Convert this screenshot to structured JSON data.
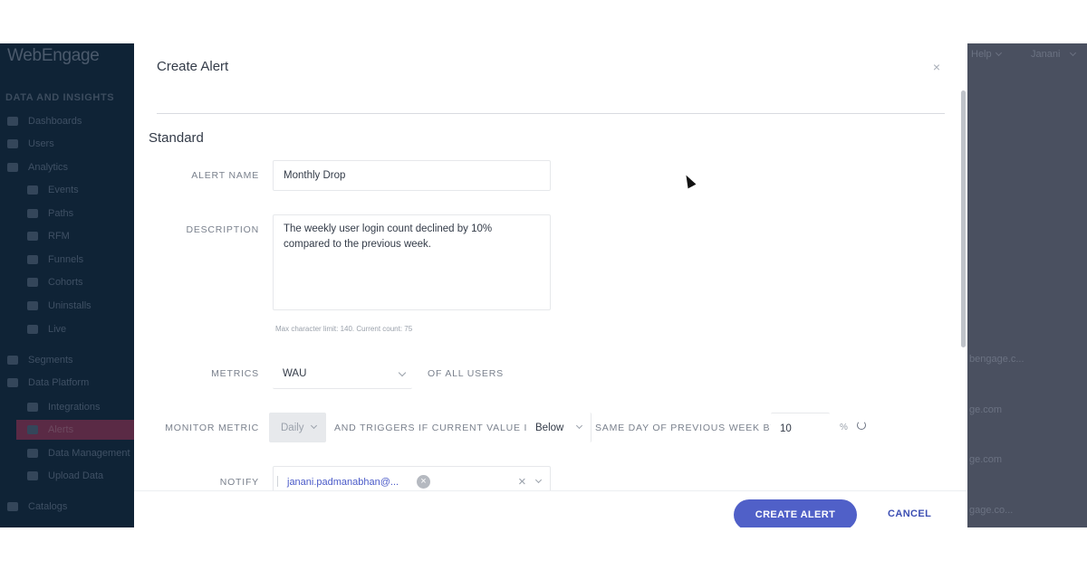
{
  "app": {
    "logo_text": "WebEngage",
    "section_data_insights": "DATA AND INSIGHTS",
    "nav": [
      {
        "label": "Dashboards"
      },
      {
        "label": "Users"
      },
      {
        "label": "Analytics"
      },
      {
        "label": "Events"
      },
      {
        "label": "Paths"
      },
      {
        "label": "RFM"
      },
      {
        "label": "Funnels"
      },
      {
        "label": "Cohorts"
      },
      {
        "label": "Uninstalls"
      },
      {
        "label": "Live"
      },
      {
        "label": "Segments"
      },
      {
        "label": "Data Platform"
      },
      {
        "label": "Integrations"
      },
      {
        "label": "Alerts"
      },
      {
        "label": "Data Management"
      },
      {
        "label": "Upload Data"
      },
      {
        "label": "Catalogs"
      }
    ],
    "top_help": "Help",
    "top_user": "Janani",
    "bg_emails": [
      "bengage.c...",
      "ge.com",
      "ge.com",
      "gage.co..."
    ]
  },
  "modal": {
    "title": "Create Alert",
    "close_glyph": "×",
    "section_title": "Standard",
    "alert_name": {
      "label": "ALERT NAME",
      "value": "Monthly Drop"
    },
    "description": {
      "label": "DESCRIPTION",
      "value": "The weekly user login count declined by 10% compared to the previous week.",
      "hint": "Max character limit: 140. Current count: 75"
    },
    "metrics": {
      "label": "METRICS",
      "value": "WAU",
      "suffix": "OF ALL USERS"
    },
    "monitor": {
      "label": "MONITOR METRIC",
      "frequency": "Daily",
      "trigger_text": "AND TRIGGERS IF CURRENT VALUE IS",
      "direction": "Below",
      "compare_text": "SAME DAY OF PREVIOUS WEEK BY",
      "threshold": "10",
      "unit": "%"
    },
    "notify": {
      "label": "NOTIFY",
      "chip": "janani.padmanabhan@...",
      "clear_glyph": "×"
    },
    "footer": {
      "create_label": "CREATE ALERT",
      "cancel_label": "CANCEL"
    }
  }
}
